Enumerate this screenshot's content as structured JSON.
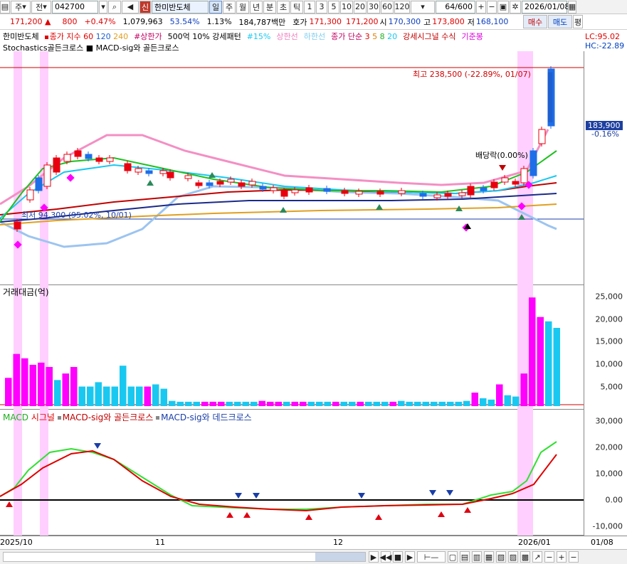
{
  "toolbar": {
    "market": "주",
    "prev": "전",
    "code": "042700",
    "signal_btn": "신",
    "stock_name": "한미반도체",
    "periods": [
      "일",
      "주",
      "월",
      "년",
      "분",
      "초",
      "틱"
    ],
    "intervals": [
      "1",
      "3",
      "5",
      "10",
      "20",
      "30",
      "60",
      "120"
    ],
    "count": "64",
    "count_total": "/600",
    "date": "2026/01/08",
    "buy": "매수",
    "sell": "매도",
    "extra": "평"
  },
  "quote": {
    "price": "171,200",
    "arrow": "▲",
    "change": "800",
    "pct": "+0.47%",
    "volume": "1,079,963",
    "ratio": "53.54%",
    "turnover": "1.13%",
    "amount": "184,787백만",
    "bid_label": "호가",
    "bid1": "171,300",
    "bid2": "171,200",
    "open_label": "시",
    "open": "170,300",
    "high_label": "고",
    "high": "173,800",
    "low_label": "저",
    "low": "168,100"
  },
  "legend": {
    "name": "한미반도체",
    "ma_label": "종가 지수",
    "ma60": "60",
    "ma120": "120",
    "ma240": "240",
    "limit_up": "#상한가",
    "pattern": "500억 10% 강세패턴",
    "pct15": "#15%",
    "upper": "상한선",
    "lower": "하한선",
    "simple": "종가 단순",
    "s3": "3",
    "s5": "5",
    "s8": "8",
    "s20": "20",
    "strong": "강세시그널 수식",
    "base": "기준봉",
    "line2": "Stochastics골든크로스 ■ MACD-sig와 골든크로스",
    "lc": "LC:95.02",
    "hc": "HC:-22.89"
  },
  "price_panel": {
    "max_label": "최고 238,500 (-22.89%, 01/07)",
    "min_label": "최저 94,300 (95.02%, 10/01)",
    "dividend": "배당락(0.00%)",
    "current": "183,900",
    "current_pct": "-0.16%"
  },
  "volume_panel": {
    "title": "거래대금(억)",
    "ticks": [
      "25,000",
      "20,000",
      "15,000",
      "10,000",
      "5,000"
    ],
    "values": [
      6500,
      12000,
      11000,
      9500,
      10000,
      9000,
      6000,
      7500,
      9000,
      4500,
      4500,
      5500,
      4500,
      4500,
      9300,
      4500,
      4500,
      4500,
      5000,
      4000,
      1200,
      1000,
      1000,
      1000,
      1000,
      1000,
      1000,
      1000,
      1000,
      1000,
      1000,
      1200,
      1000,
      1000,
      1000,
      1000,
      1000,
      1000,
      1000,
      1000,
      1000,
      1000,
      1000,
      1000,
      1000,
      1000,
      1000,
      1000,
      1200,
      1000,
      1000,
      1000,
      1000,
      1000,
      1000,
      1000,
      1200,
      3100,
      1800,
      1500,
      5000,
      2500,
      2200,
      7500,
      25000,
      20500,
      19500,
      18000
    ],
    "colors": [
      "m",
      "m",
      "m",
      "m",
      "m",
      "m",
      "c",
      "m",
      "m",
      "c",
      "c",
      "c",
      "c",
      "c",
      "c",
      "c",
      "c",
      "m",
      "c",
      "c",
      "c",
      "c",
      "c",
      "c",
      "m",
      "m",
      "m",
      "c",
      "c",
      "c",
      "c",
      "m",
      "m",
      "m",
      "c",
      "m",
      "m",
      "c",
      "c",
      "c",
      "m",
      "c",
      "c",
      "m",
      "c",
      "c",
      "c",
      "m",
      "c",
      "c",
      "c",
      "c",
      "c",
      "c",
      "c",
      "c",
      "c",
      "m",
      "c",
      "c",
      "m",
      "c",
      "c",
      "m",
      "m",
      "m",
      "c",
      "c"
    ]
  },
  "macd_panel": {
    "l1": "MACD",
    "l2": "시그널",
    "l3": "MACD-sig와 골든크로스",
    "l4": "MACD-sig와 데드크로스",
    "ticks": [
      "30,000",
      "20,000",
      "10,000",
      "0.00",
      "-10,000"
    ]
  },
  "dates": [
    "2025/10",
    "11",
    "12",
    "2026/01",
    "01/08"
  ],
  "colors": {
    "up": "#e8000f",
    "down": "#1e6ee8",
    "magenta": "#ff00ff",
    "cyan": "#19c8f0",
    "band": "#ffd0ff"
  }
}
